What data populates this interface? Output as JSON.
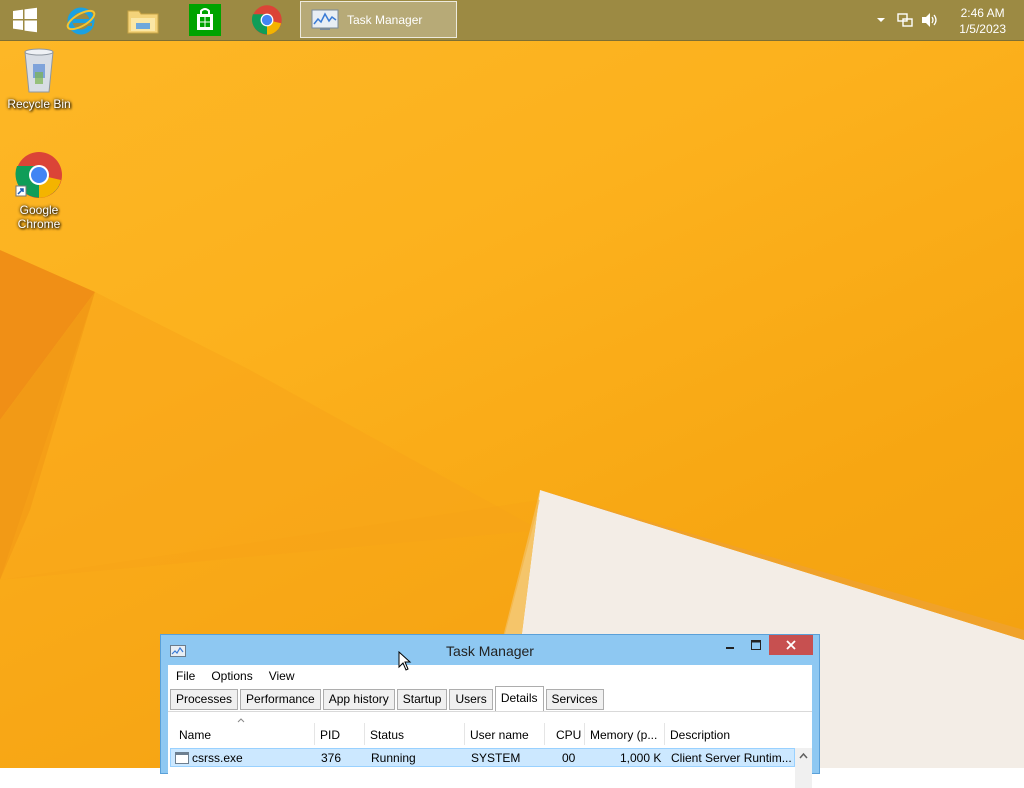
{
  "taskbar": {
    "pinned": [
      {
        "name": "Start",
        "icon": "windows-logo-icon"
      },
      {
        "name": "Internet Explorer",
        "icon": "internet-explorer-icon"
      },
      {
        "name": "File Explorer",
        "icon": "file-explorer-icon"
      },
      {
        "name": "Store",
        "icon": "store-icon"
      },
      {
        "name": "Google Chrome",
        "icon": "chrome-icon"
      }
    ],
    "active_window_label": "Task Manager",
    "clock": {
      "time": "2:46 AM",
      "date": "1/5/2023"
    }
  },
  "desktop": {
    "icons": [
      {
        "label": "Recycle Bin",
        "icon": "recycle-bin-icon"
      },
      {
        "label": "Google Chrome",
        "icon": "chrome-icon"
      }
    ]
  },
  "task_manager": {
    "title": "Task Manager",
    "menu": [
      "File",
      "Options",
      "View"
    ],
    "tabs": [
      "Processes",
      "Performance",
      "App history",
      "Startup",
      "Users",
      "Details",
      "Services"
    ],
    "active_tab": "Details",
    "columns": [
      "Name",
      "PID",
      "Status",
      "User name",
      "CPU",
      "Memory (p...",
      "Description"
    ],
    "rows": [
      {
        "name": "csrss.exe",
        "pid": "376",
        "status": "Running",
        "user": "SYSTEM",
        "cpu": "00",
        "memory": "1,000 K",
        "description": "Client Server Runtim..."
      }
    ]
  },
  "colors": {
    "wallpaper": "#fcb11d",
    "taskbar": "#9c8a43",
    "window_frame": "#8ec8f2",
    "close_button": "#c75050",
    "selection": "#cce8ff"
  }
}
